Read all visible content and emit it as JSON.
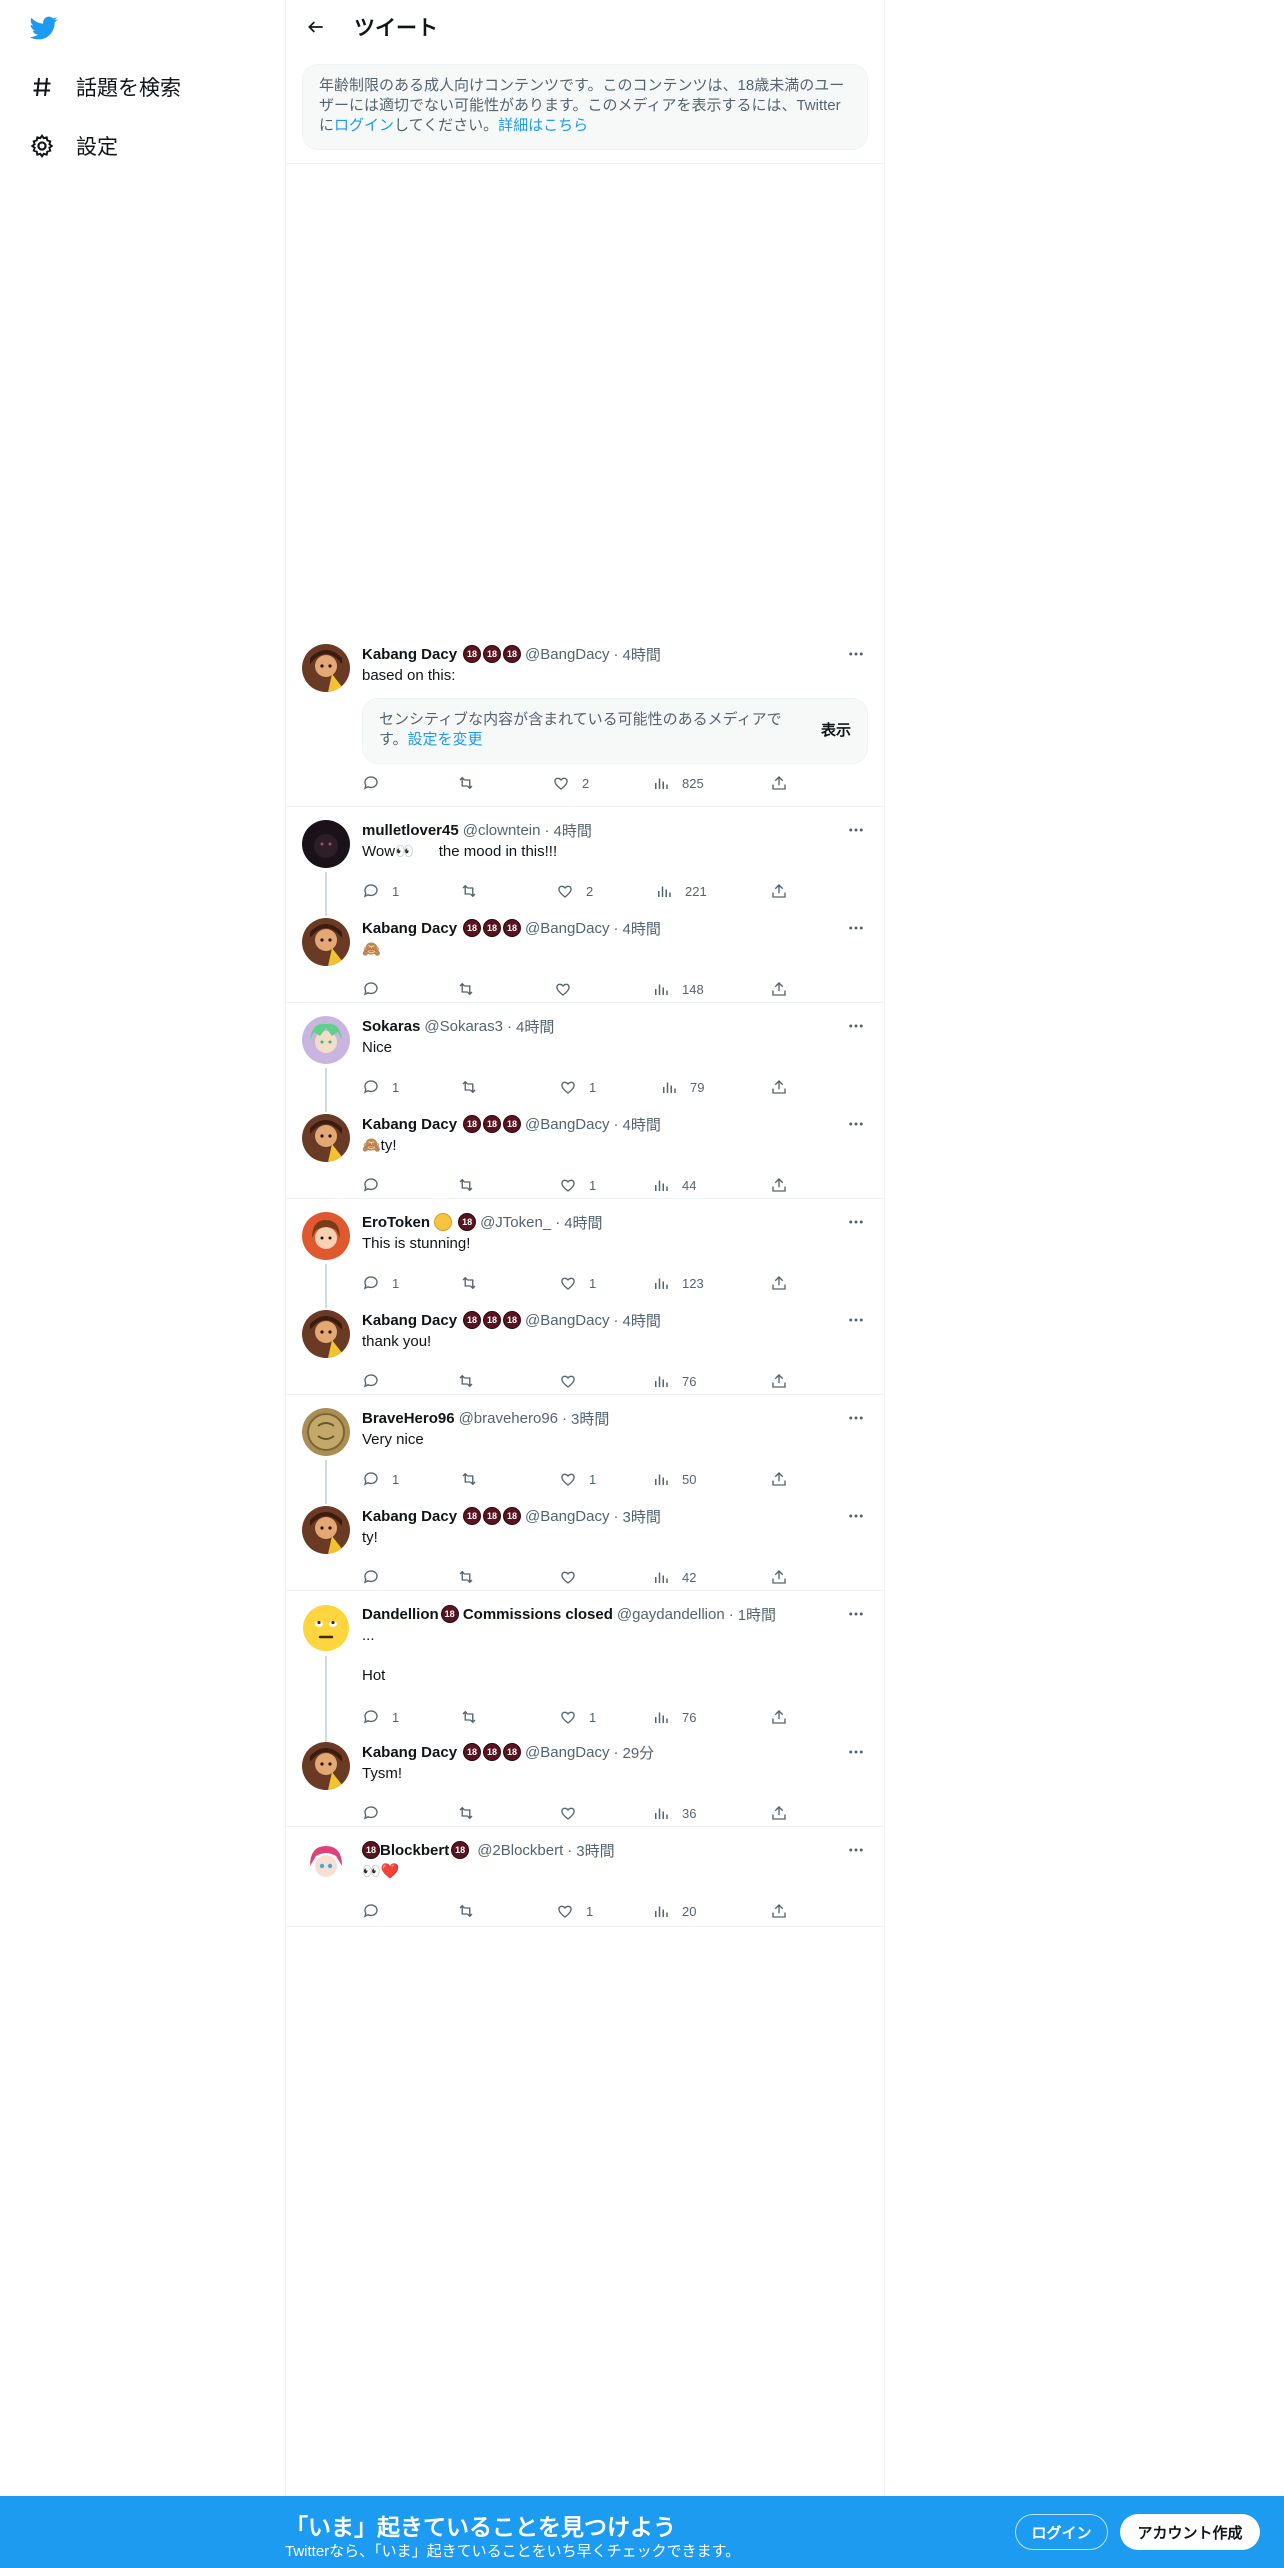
{
  "colors": {
    "accent": "#1d9bf0",
    "text": "#0f1419",
    "muted": "#536471",
    "border": "#eff3f4",
    "badge": "#5a1420"
  },
  "sidebar": {
    "logo_icon": "twitter-bird-icon",
    "items": [
      {
        "label": "話題を検索",
        "icon": "hashtag-icon"
      },
      {
        "label": "設定",
        "icon": "gear-icon"
      }
    ]
  },
  "header": {
    "title": "ツイート",
    "back_icon": "arrow-left-icon"
  },
  "warning": {
    "text_before": "年齢制限のある成人向けコンテンツです。このコンテンツは、18歳未満のユーザーには適切でない可能性があります。このメディアを表示するには、Twitterに",
    "login_link": "ログイン",
    "text_after": "してください。",
    "more_link": "詳細はこちら"
  },
  "badge_text": "18",
  "sensitive": {
    "text": "センシティブな内容が含まれている可能性のあるメディアです。",
    "link": "設定を変更",
    "show": "表示"
  },
  "tweets": [
    {
      "name": "Kabang Dacy",
      "handle": "@BangDacy",
      "time": "4時間",
      "text": "based on this:",
      "reply": "",
      "retweet": "",
      "like": "2",
      "views": "825"
    },
    {
      "name": "mulletlover45",
      "handle": "@clowntein",
      "time": "4時間",
      "text": "Wow👀      the mood in this!!!",
      "reply": "1",
      "retweet": "",
      "like": "2",
      "views": "221"
    },
    {
      "name": "Kabang Dacy",
      "handle": "@BangDacy",
      "time": "4時間",
      "text": "🙈",
      "reply": "",
      "retweet": "",
      "like": "",
      "views": "148"
    },
    {
      "name": "Sokaras",
      "handle": "@Sokaras3",
      "time": "4時間",
      "text": "Nice",
      "reply": "1",
      "retweet": "",
      "like": "1",
      "views": "79"
    },
    {
      "name": "Kabang Dacy",
      "handle": "@BangDacy",
      "time": "4時間",
      "text": "🙈ty!",
      "reply": "",
      "retweet": "",
      "like": "1",
      "views": "44"
    },
    {
      "name": "EroToken",
      "handle": "@JToken_",
      "time": "4時間",
      "text": "This is stunning!",
      "reply": "1",
      "retweet": "",
      "like": "1",
      "views": "123"
    },
    {
      "name": "Kabang Dacy",
      "handle": "@BangDacy",
      "time": "4時間",
      "text": "thank you!",
      "reply": "",
      "retweet": "",
      "like": "",
      "views": "76"
    },
    {
      "name": "BraveHero96",
      "handle": "@bravehero96",
      "time": "3時間",
      "text": "Very nice",
      "reply": "1",
      "retweet": "",
      "like": "1",
      "views": "50"
    },
    {
      "name": "Kabang Dacy",
      "handle": "@BangDacy",
      "time": "3時間",
      "text": "ty!",
      "reply": "",
      "retweet": "",
      "like": "",
      "views": "42"
    },
    {
      "name": "Dandellion",
      "name_suffix": " Commissions closed",
      "handle": "@gaydandellion",
      "time": "1時間",
      "text": "...\n\nHot",
      "reply": "1",
      "retweet": "",
      "like": "1",
      "views": "76"
    },
    {
      "name": "Kabang Dacy",
      "handle": "@BangDacy",
      "time": "29分",
      "text": "Tysm!",
      "reply": "",
      "retweet": "",
      "like": "",
      "views": "36"
    },
    {
      "name": "Blockbert",
      "handle": "@2Blockbert",
      "time": "3時間",
      "text": "👀❤️",
      "reply": "",
      "retweet": "",
      "like": "1",
      "views": "20"
    }
  ],
  "bottom_bar": {
    "title": "「いま」起きていることを見つけよう",
    "subtitle": "Twitterなら、「いま」起きていることをいち早くチェックできます。",
    "login": "ログイン",
    "signup": "アカウント作成"
  }
}
